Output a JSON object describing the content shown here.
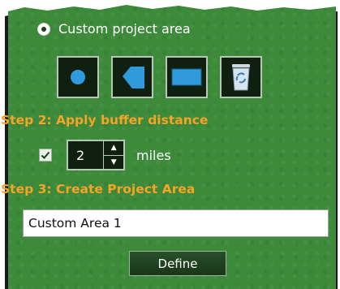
{
  "custom_area": {
    "label": "Custom project area",
    "selected": true
  },
  "draw_tools": [
    {
      "name": "circle-tool",
      "icon": "circle-icon"
    },
    {
      "name": "polygon-tool",
      "icon": "polygon-icon"
    },
    {
      "name": "rectangle-tool",
      "icon": "rectangle-icon"
    },
    {
      "name": "delete-tool",
      "icon": "recycle-bin-icon"
    }
  ],
  "step2": {
    "title": "Step 2: Apply buffer distance",
    "checked": true,
    "value": "2",
    "unit": "miles"
  },
  "step3": {
    "title": "Step 3: Create Project Area",
    "area_name": "Custom Area 1",
    "define_label": "Define"
  },
  "colors": {
    "panel_green": "#3c8a3a",
    "step_orange": "#f7a325",
    "tool_blue": "#2f9bdc"
  }
}
